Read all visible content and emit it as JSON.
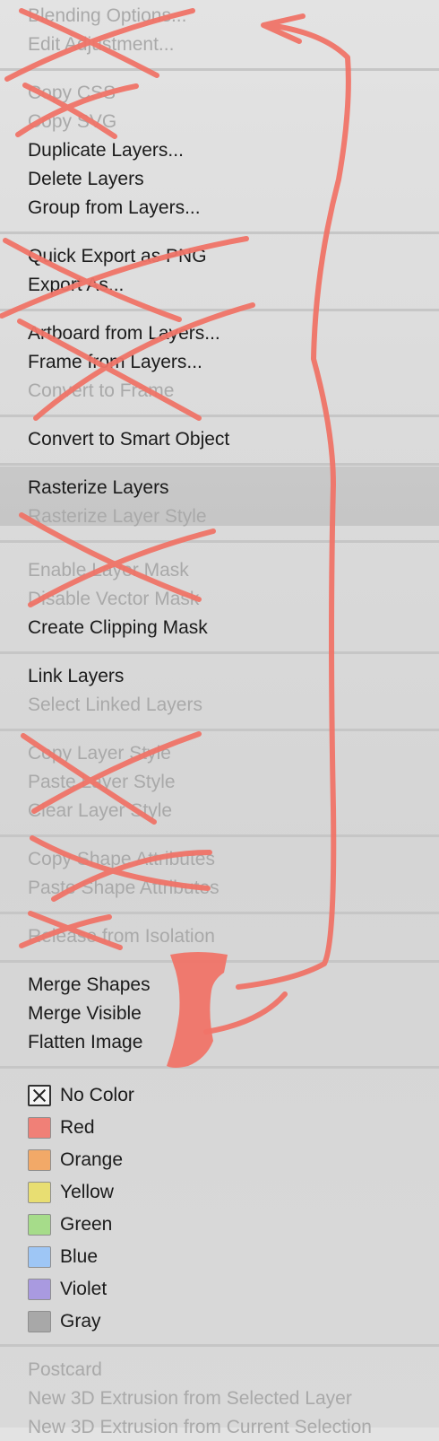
{
  "menu": {
    "items": [
      {
        "label": "Blending Options...",
        "disabled": true
      },
      {
        "label": "Edit Adjustment...",
        "disabled": true
      },
      {
        "label": "Copy CSS",
        "disabled": true
      },
      {
        "label": "Copy SVG",
        "disabled": true
      },
      {
        "label": "Duplicate Layers...",
        "disabled": false
      },
      {
        "label": "Delete Layers",
        "disabled": false
      },
      {
        "label": "Group from Layers...",
        "disabled": false
      },
      {
        "label": "Quick Export as PNG",
        "disabled": false
      },
      {
        "label": "Export As...",
        "disabled": false
      },
      {
        "label": "Artboard from Layers...",
        "disabled": false
      },
      {
        "label": "Frame from Layers...",
        "disabled": false
      },
      {
        "label": "Convert to Frame",
        "disabled": true
      },
      {
        "label": "Convert to Smart Object",
        "disabled": false
      },
      {
        "label": "Rasterize Layers",
        "disabled": false
      },
      {
        "label": "Rasterize Layer Style",
        "disabled": true
      },
      {
        "label": "Enable Layer Mask",
        "disabled": true
      },
      {
        "label": "Disable Vector Mask",
        "disabled": true
      },
      {
        "label": "Create Clipping Mask",
        "disabled": false
      },
      {
        "label": "Link Layers",
        "disabled": false
      },
      {
        "label": "Select Linked Layers",
        "disabled": true
      },
      {
        "label": "Copy Layer Style",
        "disabled": true
      },
      {
        "label": "Paste Layer Style",
        "disabled": true
      },
      {
        "label": "Clear Layer Style",
        "disabled": true
      },
      {
        "label": "Copy Shape Attributes",
        "disabled": true
      },
      {
        "label": "Paste Shape Attributes",
        "disabled": true
      },
      {
        "label": "Release from Isolation",
        "disabled": true
      },
      {
        "label": "Merge Shapes",
        "disabled": false
      },
      {
        "label": "Merge Visible",
        "disabled": false
      },
      {
        "label": "Flatten Image",
        "disabled": false
      }
    ],
    "colors": [
      {
        "label": "No Color",
        "swatch": "none"
      },
      {
        "label": "Red",
        "swatch": "#f08077"
      },
      {
        "label": "Orange",
        "swatch": "#f2a968"
      },
      {
        "label": "Yellow",
        "swatch": "#e8de72"
      },
      {
        "label": "Green",
        "swatch": "#a6dc8a"
      },
      {
        "label": "Blue",
        "swatch": "#9ec6f5"
      },
      {
        "label": "Violet",
        "swatch": "#a99ae0"
      },
      {
        "label": "Gray",
        "swatch": "#a8a8a8"
      }
    ],
    "footer_items": [
      {
        "label": "Postcard",
        "disabled": true
      },
      {
        "label": "New 3D Extrusion from Selected Layer",
        "disabled": true
      },
      {
        "label": "New 3D Extrusion from Current Selection",
        "disabled": true
      }
    ]
  },
  "annotation": {
    "stroke_color": "#f07468"
  },
  "theme": {
    "highlight_bg": "#c9c9c9",
    "text": "#1b1b1b",
    "disabled_text": "#a9a9a9",
    "separator": "#c6c6c6"
  }
}
